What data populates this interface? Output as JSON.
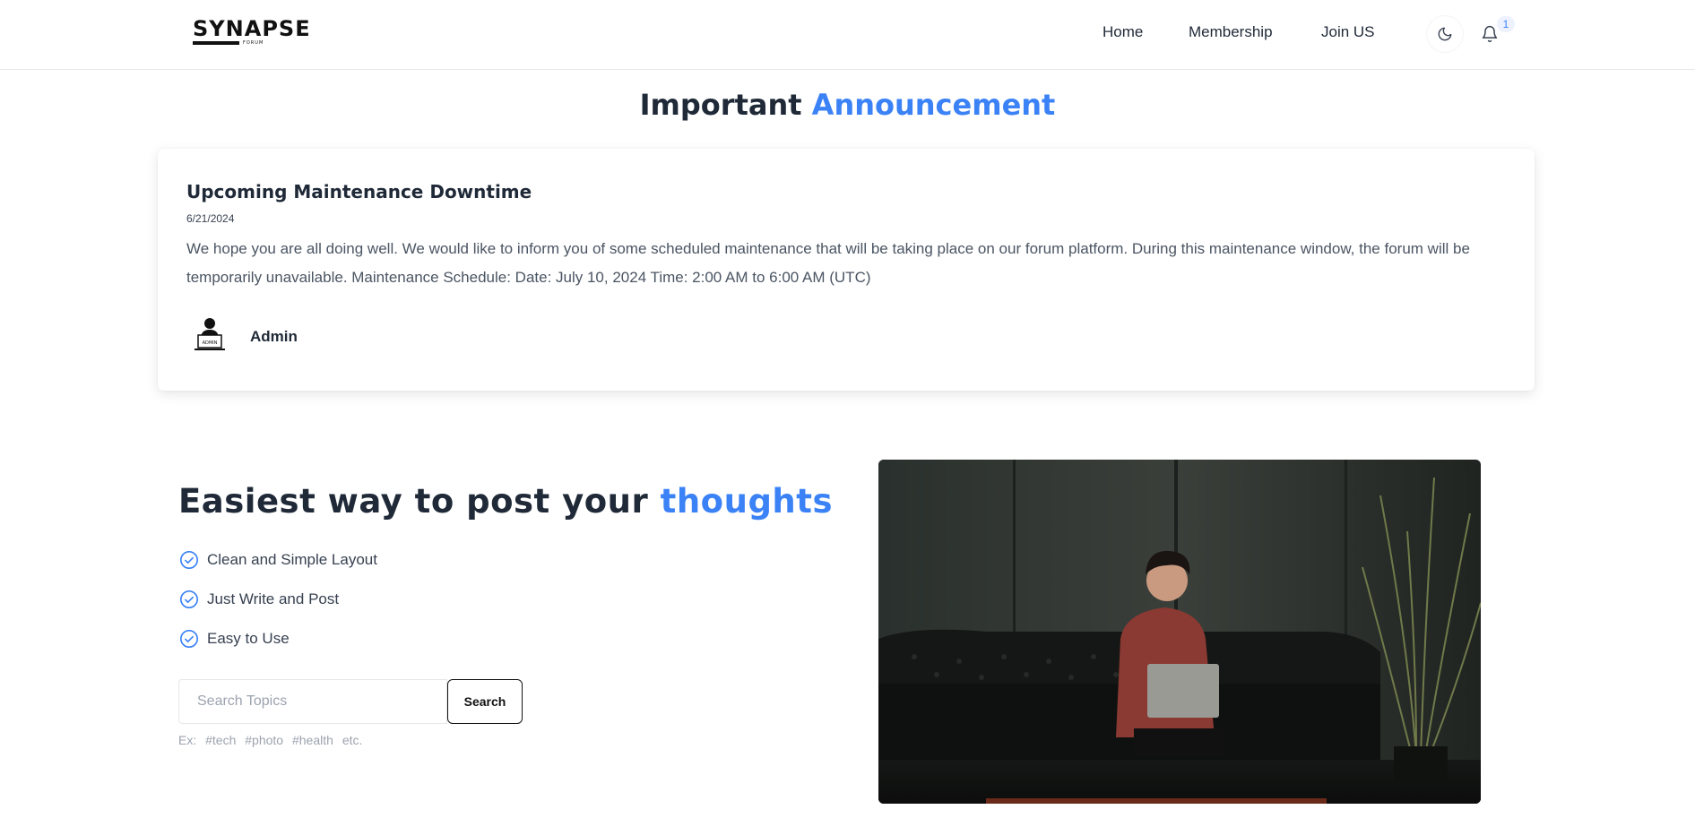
{
  "header": {
    "logo_text": "SYNAPSE",
    "logo_sub": "FORUM",
    "nav": [
      "Home",
      "Membership",
      "Join US"
    ],
    "notification_count": "1",
    "icons": [
      "moon-icon",
      "bell-icon"
    ]
  },
  "announcement": {
    "heading_main": "Important",
    "heading_accent": "Announcement",
    "title": "Upcoming Maintenance Downtime",
    "date": "6/21/2024",
    "body": "We hope you are all doing well. We would like to inform you of some scheduled maintenance that will be taking place on our forum platform. During this maintenance window, the forum will be temporarily unavailable. Maintenance Schedule: Date: July 10, 2024 Time: 2:00 AM to 6:00 AM (UTC)",
    "author": "Admin",
    "avatar_text": "ADMIN"
  },
  "hero": {
    "title_main": "Easiest way to post your",
    "title_accent": "thoughts",
    "features": [
      "Clean and Simple Layout",
      "Just Write and Post",
      "Easy to Use"
    ],
    "search_placeholder": "Search Topics",
    "search_button": "Search",
    "hint_prefix": "Ex:",
    "hint_tags": [
      "#tech",
      "#photo",
      "#health",
      "etc."
    ]
  },
  "colors": {
    "accent": "#3b82f6",
    "text": "#1f2937"
  }
}
